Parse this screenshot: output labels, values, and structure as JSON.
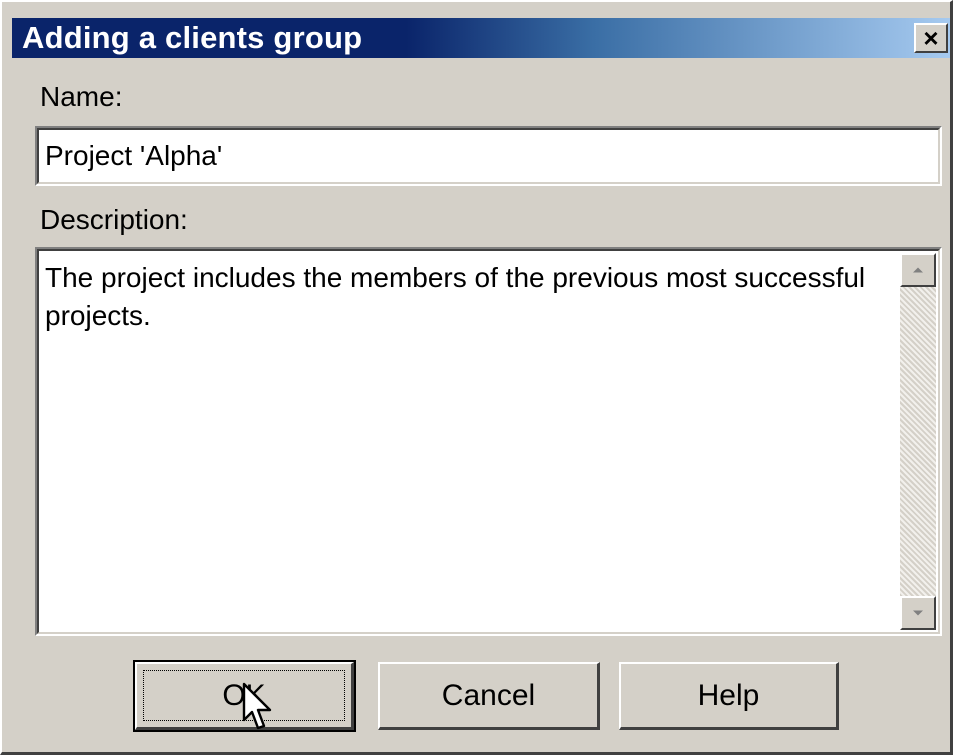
{
  "dialog": {
    "title": "Adding a clients group",
    "close_glyph": "×",
    "name_label": "Name:",
    "name_value": "Project 'Alpha'",
    "description_label": "Description:",
    "description_value": "The project includes the members of the previous most successful projects.",
    "buttons": {
      "ok": "OK",
      "cancel": "Cancel",
      "help": "Help"
    },
    "icons": {
      "close": "close-icon",
      "scroll_up": "scroll-up-arrow-icon",
      "scroll_down": "scroll-down-arrow-icon",
      "cursor": "mouse-pointer-icon"
    },
    "colors": {
      "title_bar_start": "#0a246a",
      "title_bar_end": "#a6caf0",
      "dialog_face": "#d4d0c8"
    }
  }
}
